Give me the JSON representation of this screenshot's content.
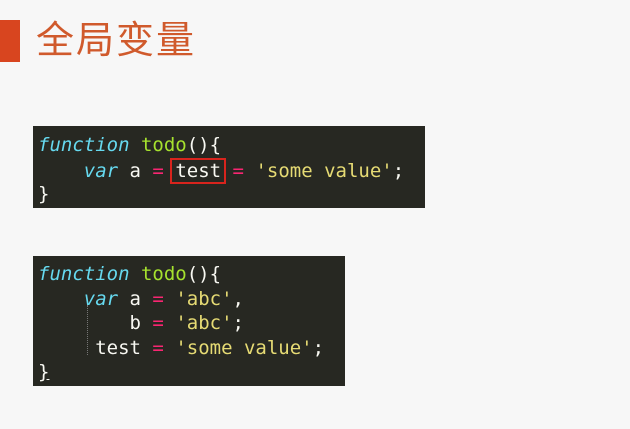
{
  "slide": {
    "title": "全局变量",
    "accent_color": "#d8451f",
    "title_color": "#d05a2c"
  },
  "code1": {
    "line1": {
      "kw": "function",
      "fn": "todo",
      "punct": "(){"
    },
    "line2": {
      "indent": "    ",
      "kw": "var",
      "ident_a": " a ",
      "eq1": "=",
      "highlight": "test",
      "eq2": "=",
      "str": "'some value'",
      "end": ";"
    },
    "line3": {
      "brace": "}"
    }
  },
  "code2": {
    "line1": {
      "kw": "function",
      "fn": "todo",
      "punct": "(){"
    },
    "line2": {
      "indent": "    ",
      "kw": "var",
      "ident": " a ",
      "eq": "=",
      "str": "'abc'",
      "end": ","
    },
    "line3": {
      "indent": "        ",
      "ident": "b ",
      "eq": "=",
      "str": "'abc'",
      "end": ";"
    },
    "line4": {
      "indent": "     ",
      "ident": "test ",
      "eq": "=",
      "str": "'some value'",
      "end": ";"
    },
    "line5": {
      "brace": "}"
    }
  },
  "theme": {
    "code_bg": "#272822",
    "keyword": "#66d9ef",
    "function_name": "#a6e22e",
    "operator": "#f92672",
    "string": "#e6db74",
    "highlight_border": "#d8241d"
  }
}
